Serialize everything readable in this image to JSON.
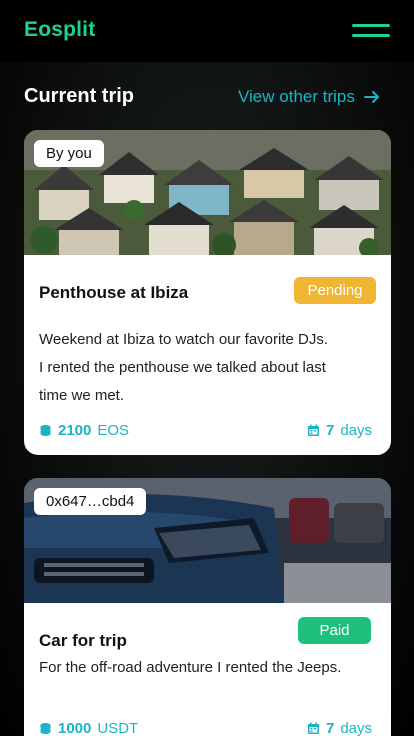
{
  "app": {
    "name": "Eosplit"
  },
  "section": {
    "title": "Current trip",
    "view_other": "View other trips"
  },
  "trips": [
    {
      "owner": "By you",
      "title": "Penthouse at Ibiza",
      "status": "Pending",
      "description_lines": [
        "Weekend at Ibiza to watch our favorite DJs.",
        "I rented the penthouse we talked about last",
        "time we met."
      ],
      "amount": "2100",
      "currency": "EOS",
      "duration": "7",
      "duration_unit": "days",
      "image": "houses-aerial-photo"
    },
    {
      "owner": "0x647…cbd4",
      "title": "Car for trip",
      "status": "Paid",
      "description_lines": [
        "For the off-road adventure I rented the Jeeps."
      ],
      "amount": "1000",
      "currency": "USDT",
      "duration": "7",
      "duration_unit": "days",
      "image": "car-front-photo"
    }
  ],
  "colors": {
    "accent": "#1ed38b",
    "link": "#19b5c7",
    "pending": "#f0b532",
    "paid": "#1ec17c"
  },
  "icons": {
    "menu": "hamburger-icon",
    "arrow": "arrow-right-icon",
    "coins": "coins-icon",
    "calendar": "calendar-icon"
  }
}
